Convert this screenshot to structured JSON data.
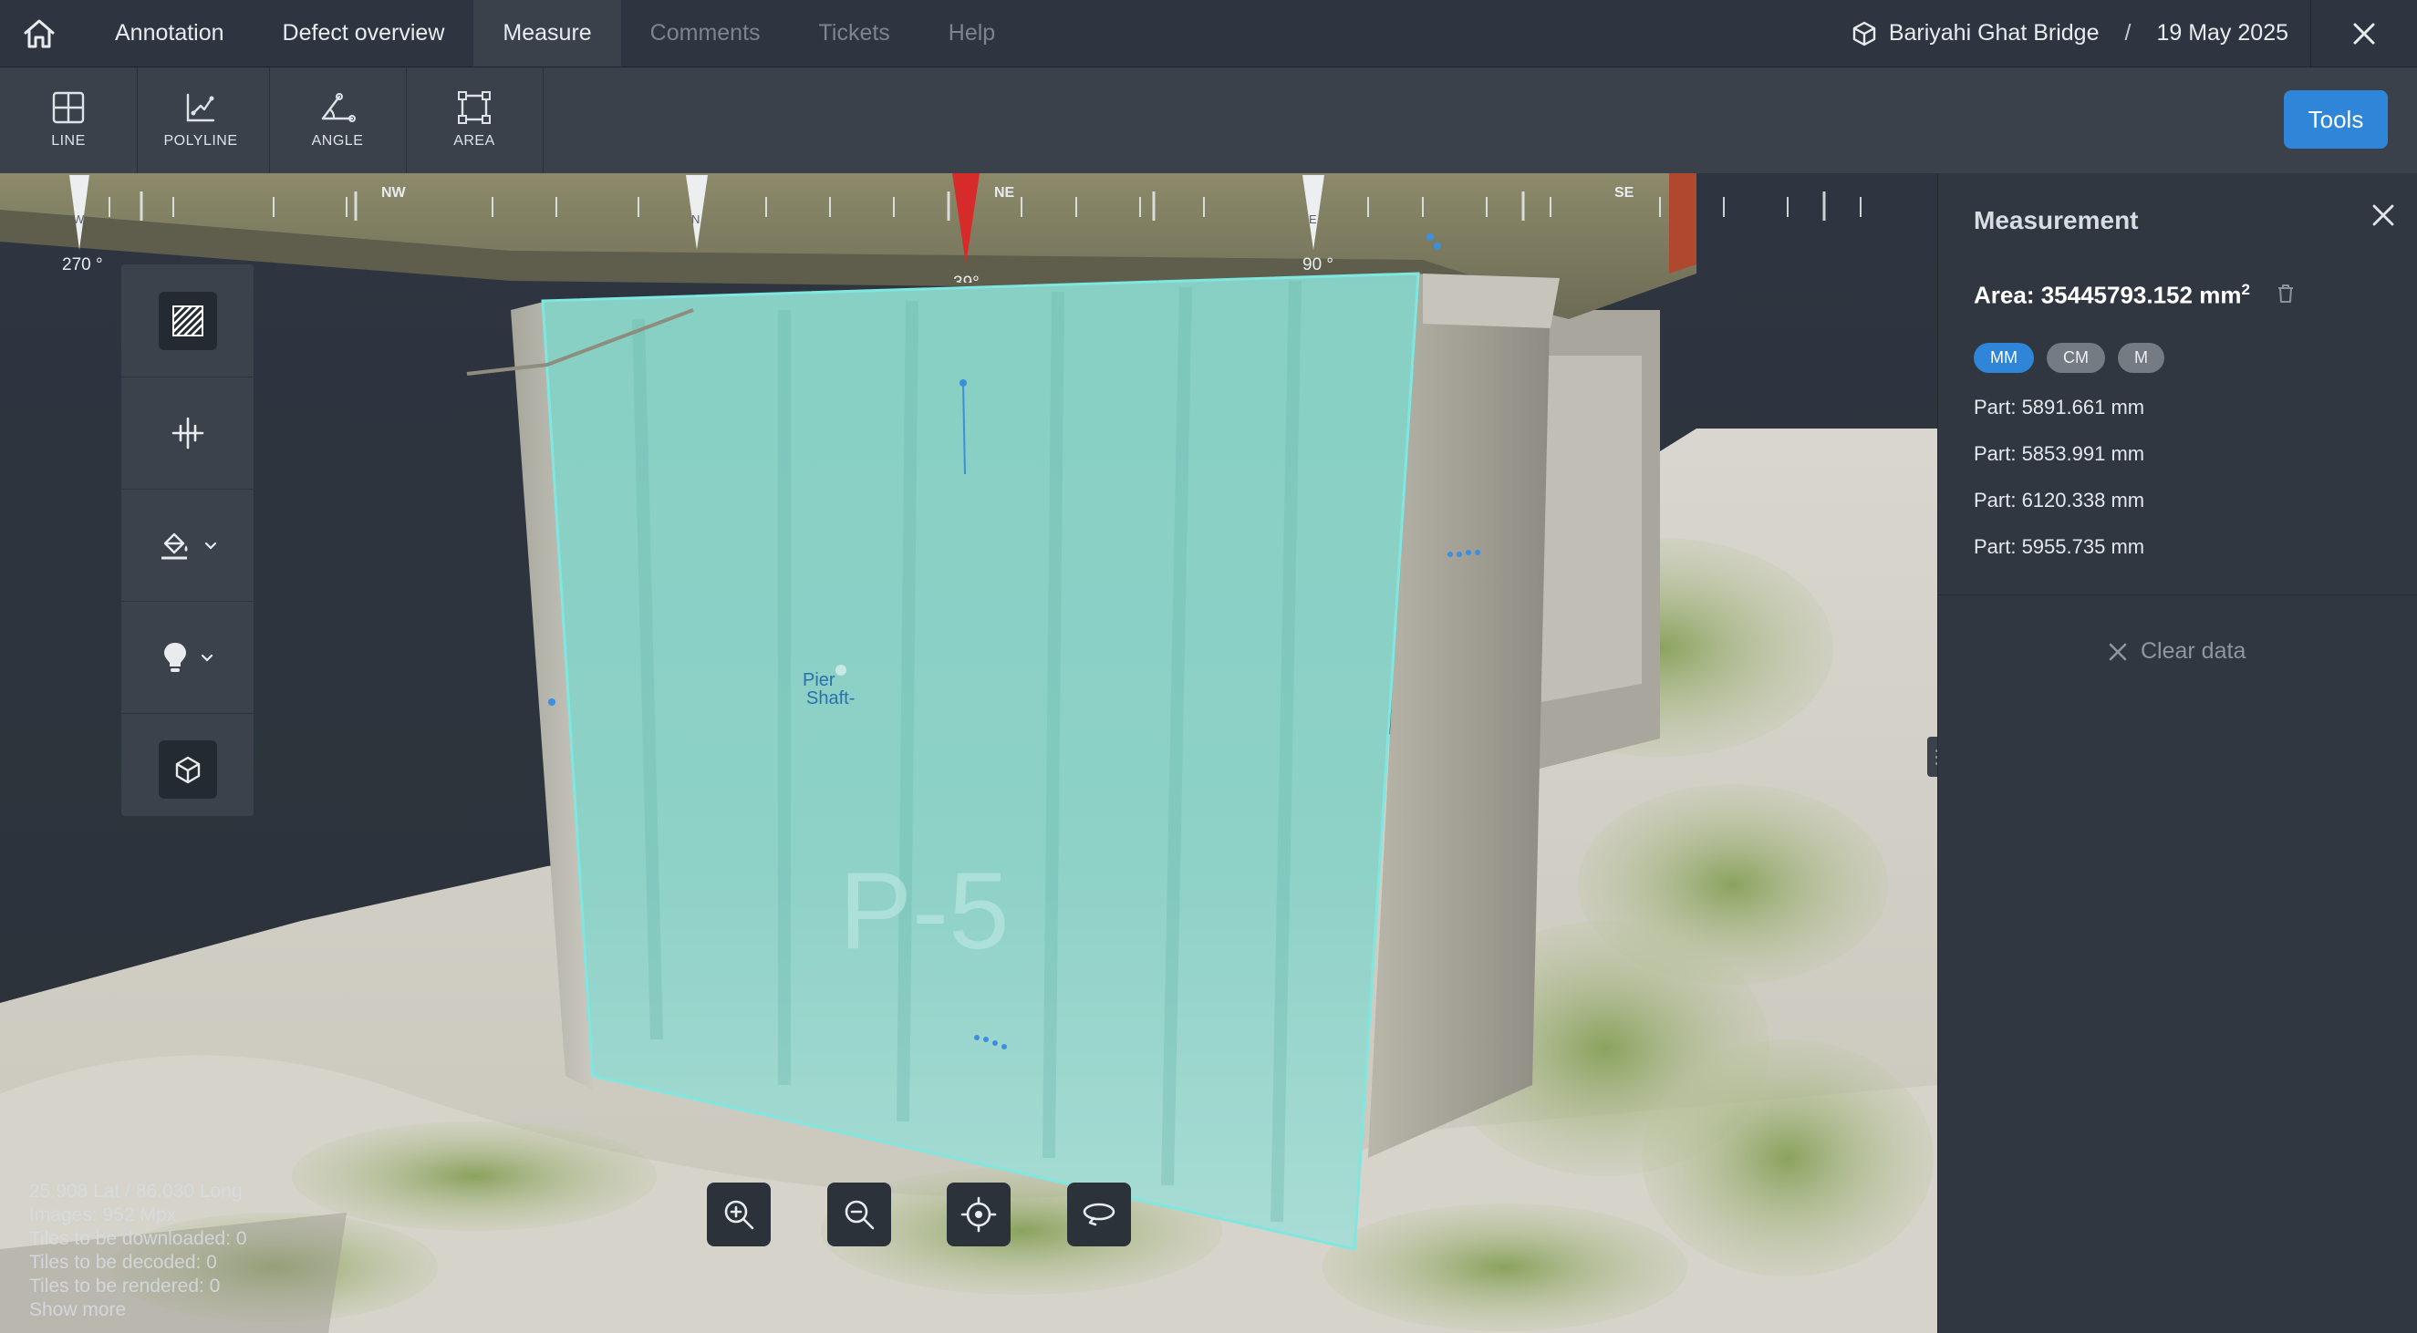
{
  "nav": {
    "tabs": [
      {
        "label": "Annotation",
        "state": "normal"
      },
      {
        "label": "Defect overview",
        "state": "normal"
      },
      {
        "label": "Measure",
        "state": "active"
      },
      {
        "label": "Comments",
        "state": "disabled"
      },
      {
        "label": "Tickets",
        "state": "disabled"
      },
      {
        "label": "Help",
        "state": "disabled"
      }
    ],
    "project_name": "Bariyahi Ghat Bridge",
    "separator": "/",
    "date": "19 May 2025"
  },
  "toolbar": {
    "tools": [
      {
        "label": "LINE",
        "icon": "line-grid-icon"
      },
      {
        "label": "POLYLINE",
        "icon": "polyline-icon"
      },
      {
        "label": "ANGLE",
        "icon": "angle-icon"
      },
      {
        "label": "AREA",
        "icon": "area-icon"
      }
    ],
    "tools_button": "Tools"
  },
  "compass": {
    "labels": [
      "270 °",
      "NW",
      "39°",
      "NE",
      "90 °",
      "SE"
    ],
    "letters": [
      "W",
      "N",
      "E"
    ],
    "heading": "39°"
  },
  "viewport": {
    "model_label_lines": [
      "Pier ",
      "Shaft-"
    ],
    "painted_text": "P-5",
    "stats": [
      "25.908 Lat / 86.030 Long",
      "Images: 952 Mpx",
      "Tiles to be downloaded: 0",
      "Tiles to be decoded: 0",
      "Tiles to be rendered: 0",
      "Show more"
    ]
  },
  "panel": {
    "title": "Measurement",
    "area_label": "Area: 35445793.152 mm",
    "area_sup": "2",
    "units": [
      {
        "label": "MM",
        "active": true
      },
      {
        "label": "CM",
        "active": false
      },
      {
        "label": "M",
        "active": false
      }
    ],
    "parts": [
      "Part: 5891.661 mm",
      "Part: 5853.991 mm",
      "Part: 6120.338 mm",
      "Part: 5955.735 mm"
    ],
    "clear_label": "Clear data"
  },
  "colors": {
    "accent": "#2f86d8",
    "measure_fill": "#7fe6e0",
    "compass_heading": "#d72b2b"
  }
}
